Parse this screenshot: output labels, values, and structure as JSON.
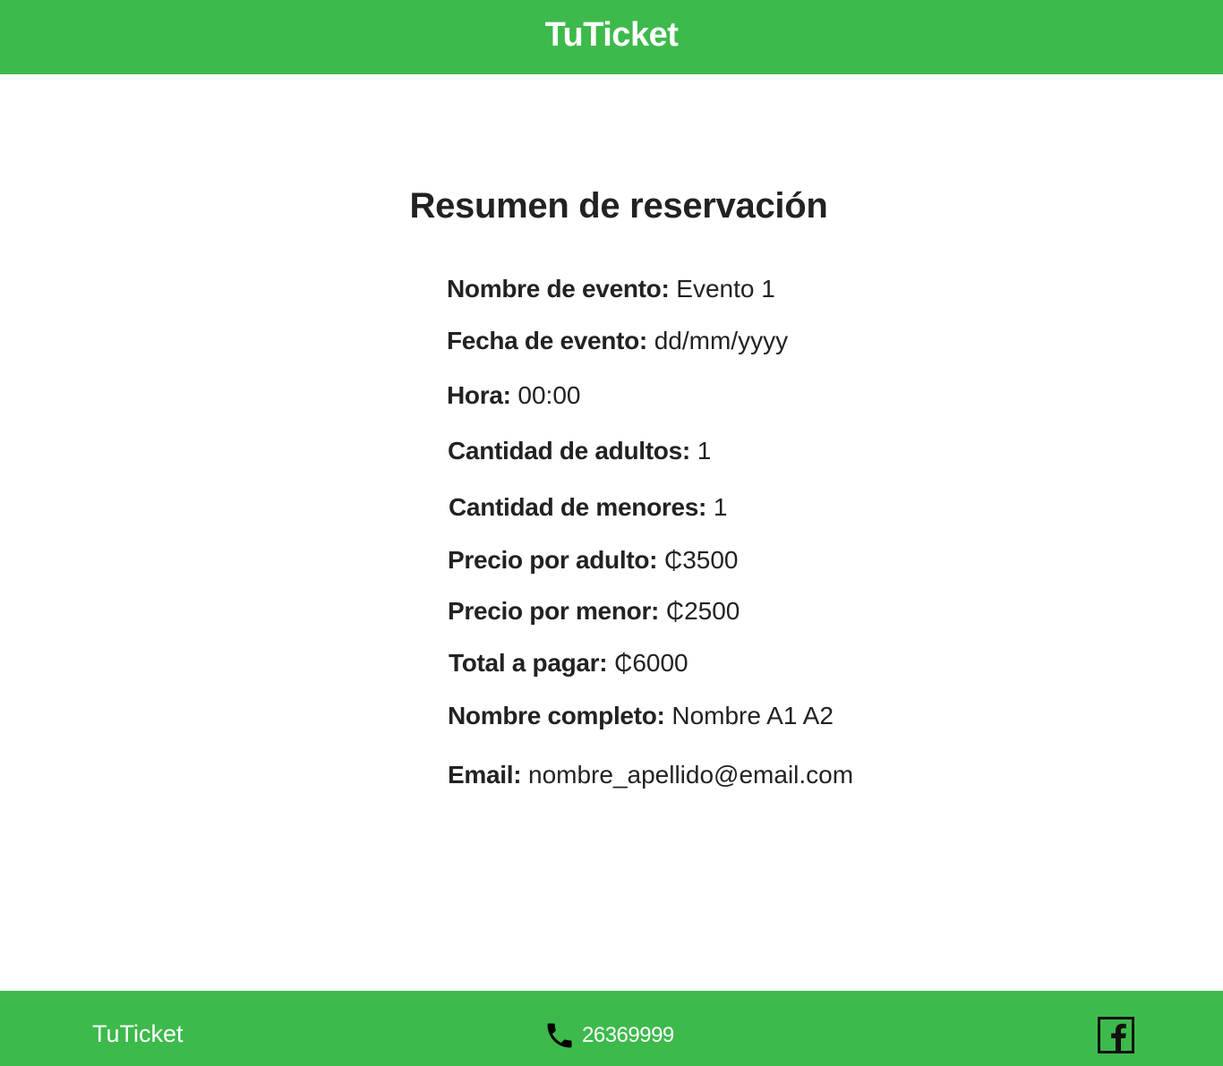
{
  "header": {
    "title": "TuTicket"
  },
  "summary": {
    "title": "Resumen de reservación",
    "rows": [
      {
        "label": "Nombre de evento:",
        "value": "Evento 1"
      },
      {
        "label": "Fecha de evento:",
        "value": "dd/mm/yyyy"
      },
      {
        "label": "Hora:",
        "value": "00:00"
      },
      {
        "label": "Cantidad de adultos:",
        "value": "1"
      },
      {
        "label": "Cantidad de menores:",
        "value": "1"
      },
      {
        "label": "Precio por adulto:",
        "value": "₵3500"
      },
      {
        "label": "Precio por menor:",
        "value": "₵2500"
      },
      {
        "label": "Total a pagar:",
        "value": "₵6000"
      },
      {
        "label": "Nombre completo:",
        "value": "Nombre A1 A2"
      },
      {
        "label": "Email:",
        "value": "nombre_apellido@email.com"
      }
    ]
  },
  "footer": {
    "brand": "TuTicket",
    "phone": "26369999",
    "phone_icon": "phone-icon",
    "social_icon": "facebook-icon"
  },
  "colors": {
    "brand_green": "#3dba4b",
    "text": "#222222",
    "header_text": "#ffffff"
  }
}
